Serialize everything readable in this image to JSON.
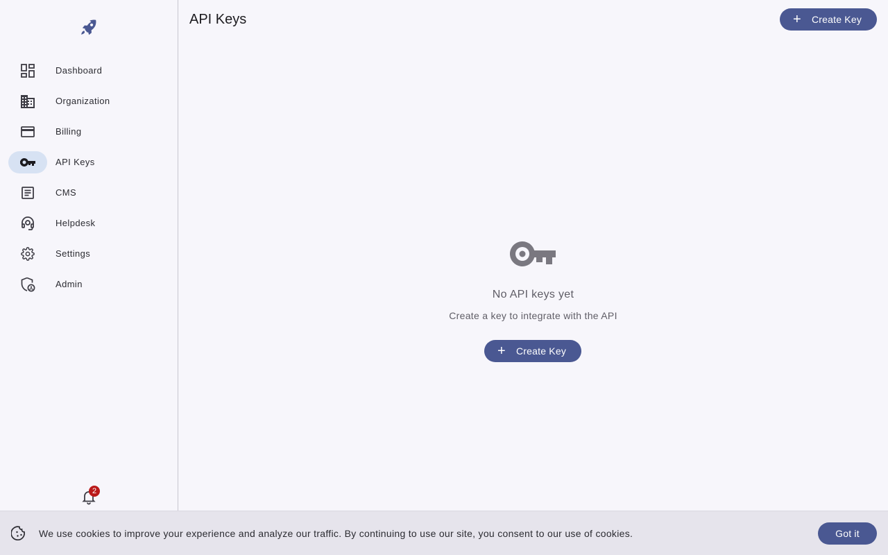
{
  "app": {
    "logo_icon": "rocket-icon"
  },
  "sidebar": {
    "items": [
      {
        "label": "Dashboard",
        "icon": "dashboard-icon",
        "active": false
      },
      {
        "label": "Organization",
        "icon": "building-icon",
        "active": false
      },
      {
        "label": "Billing",
        "icon": "credit-card-icon",
        "active": false
      },
      {
        "label": "API Keys",
        "icon": "key-icon",
        "active": true
      },
      {
        "label": "CMS",
        "icon": "article-icon",
        "active": false
      },
      {
        "label": "Helpdesk",
        "icon": "headset-icon",
        "active": false
      },
      {
        "label": "Settings",
        "icon": "gear-icon",
        "active": false
      },
      {
        "label": "Admin",
        "icon": "admin-shield-icon",
        "active": false
      }
    ],
    "notifications": {
      "icon": "bell-icon",
      "count": "2"
    }
  },
  "header": {
    "title": "API Keys",
    "create_label": "Create Key"
  },
  "empty_state": {
    "icon": "key-icon",
    "title": "No API keys yet",
    "subtitle": "Create a key to integrate with the API",
    "create_label": "Create Key"
  },
  "cookie_banner": {
    "icon": "cookie-icon",
    "text": "We use cookies to improve your experience and analyze our traffic. By continuing to use our site, you consent to our use of cookies.",
    "accept_label": "Got it"
  },
  "colors": {
    "accent": "#4a5892",
    "active_pill": "#d7e2f3",
    "badge": "#ba1a1a",
    "background": "#f7f6fb"
  }
}
